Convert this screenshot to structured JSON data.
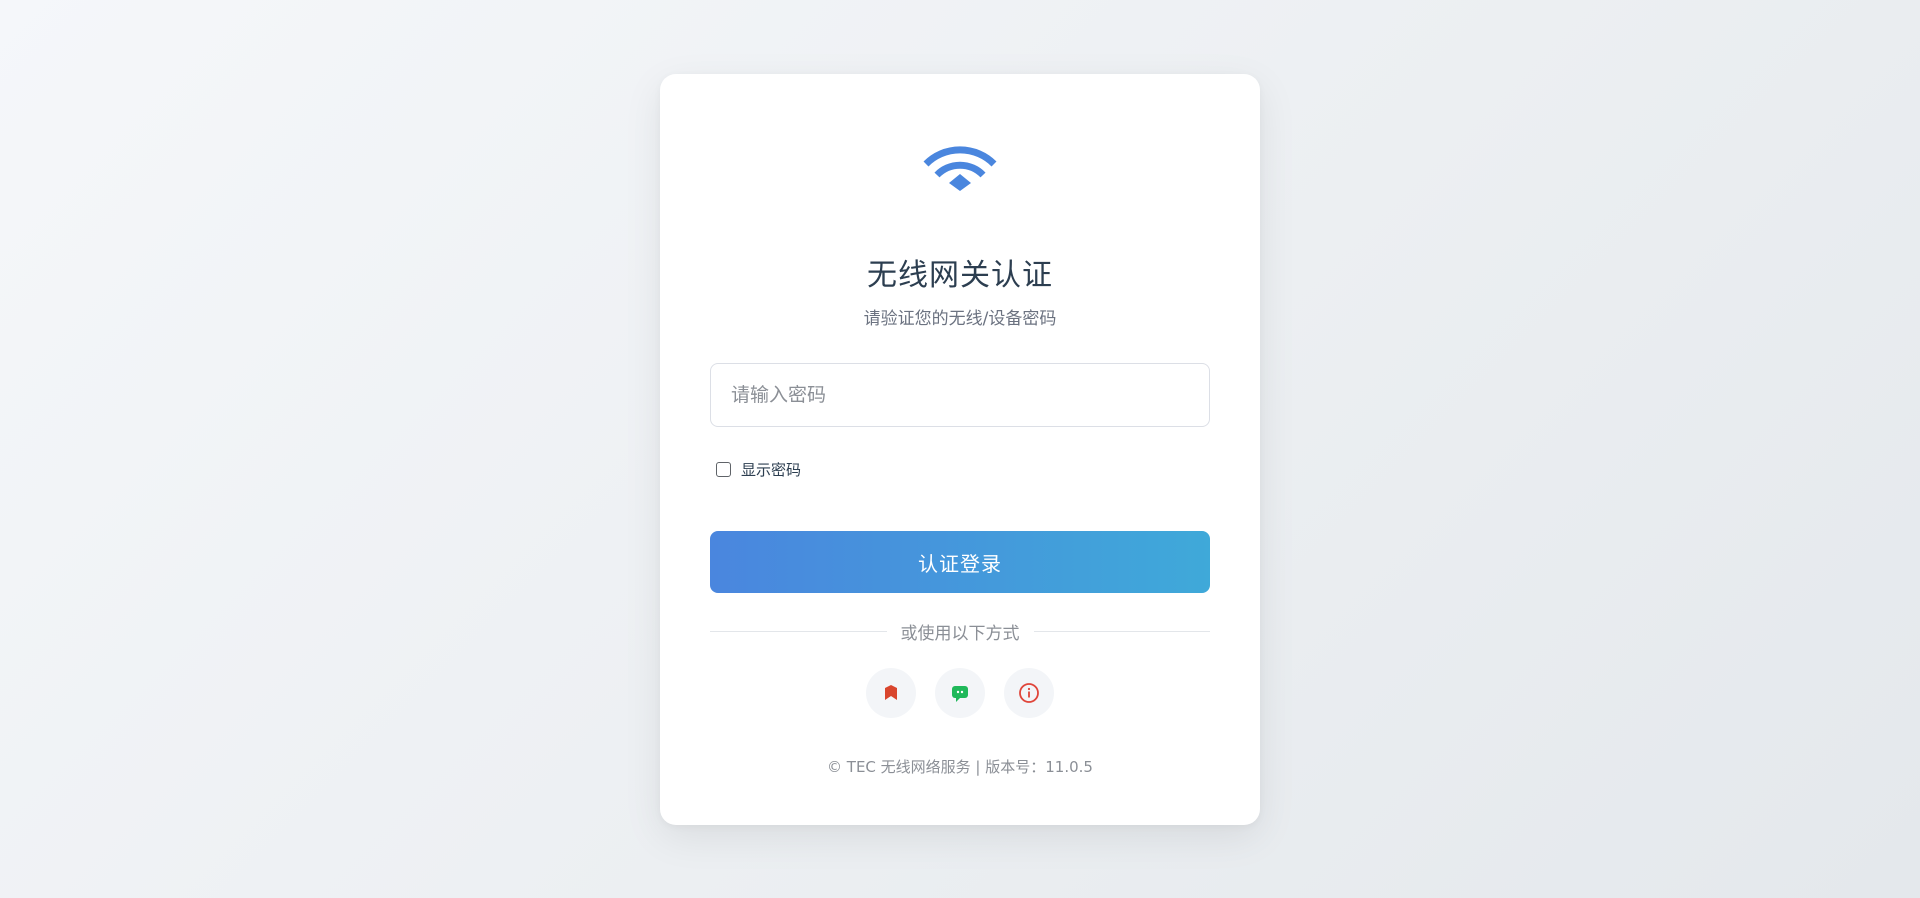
{
  "card": {
    "title": "无线网关认证",
    "subtitle": "请验证您的无线/设备密码"
  },
  "logo": {
    "icon": "wifi-icon",
    "color": "#4a86de"
  },
  "password": {
    "placeholder": "请输入密码",
    "value": ""
  },
  "show_password": {
    "label": "显示密码",
    "checked": false
  },
  "login_button": {
    "label": "认证登录",
    "gradient": [
      "#4a86de",
      "#3fa9d9"
    ]
  },
  "divider": {
    "text": "或使用以下方式"
  },
  "alt_methods": [
    {
      "icon": "bookmark-icon",
      "color": "#d9462e"
    },
    {
      "icon": "chat-icon",
      "color": "#1fb85a"
    },
    {
      "icon": "info-icon",
      "color": "#e0453a"
    }
  ],
  "footer": {
    "text": "© TEC 无线网络服务 | 版本号：11.0.5"
  }
}
